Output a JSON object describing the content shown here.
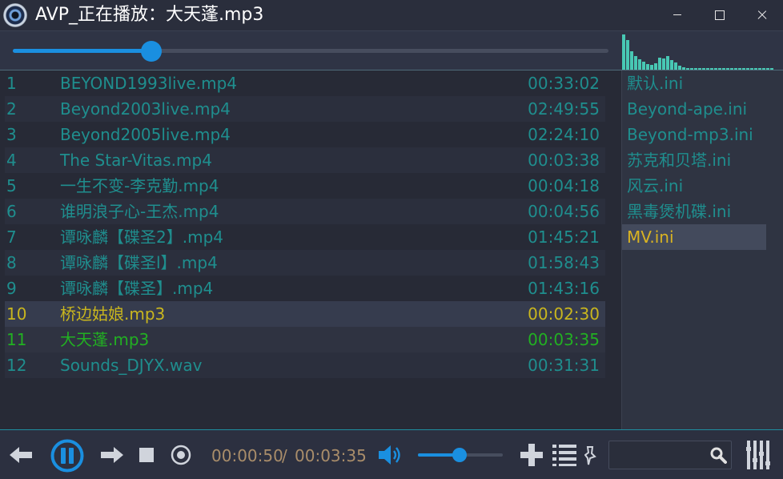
{
  "window": {
    "title": "AVP_正在播放：大天蓬.mp3"
  },
  "seek": {
    "progress": 0.232
  },
  "playlist": {
    "rows": [
      {
        "num": "1",
        "name": "BEYOND1993live.mp4",
        "duration": "00:33:02",
        "state": "normal"
      },
      {
        "num": "2",
        "name": "Beyond2003live.mp4",
        "duration": "02:49:55",
        "state": "normal"
      },
      {
        "num": "3",
        "name": "Beyond2005live.mp4",
        "duration": "02:24:10",
        "state": "normal"
      },
      {
        "num": "4",
        "name": "The Star-Vitas.mp4",
        "duration": "00:03:38",
        "state": "normal"
      },
      {
        "num": "5",
        "name": "一生不变-李克勤.mp4",
        "duration": "00:04:18",
        "state": "normal"
      },
      {
        "num": "6",
        "name": "谁明浪子心-王杰.mp4",
        "duration": "00:04:56",
        "state": "normal"
      },
      {
        "num": "7",
        "name": "谭咏麟【碟圣2】.mp4",
        "duration": "01:45:21",
        "state": "normal"
      },
      {
        "num": "8",
        "name": "谭咏麟【碟圣l】.mp4",
        "duration": "01:58:43",
        "state": "normal"
      },
      {
        "num": "9",
        "name": "谭咏麟【碟圣】.mp4",
        "duration": "01:43:16",
        "state": "normal"
      },
      {
        "num": "10",
        "name": "桥边姑娘.mp3",
        "duration": "00:02:30",
        "state": "selected"
      },
      {
        "num": "11",
        "name": "大天蓬.mp3",
        "duration": "00:03:35",
        "state": "playing"
      },
      {
        "num": "12",
        "name": "Sounds_DJYX.wav",
        "duration": "00:31:31",
        "state": "normal"
      }
    ]
  },
  "presets": {
    "items": [
      {
        "label": "默认.ini",
        "active": false
      },
      {
        "label": "Beyond-ape.ini",
        "active": false
      },
      {
        "label": "Beyond-mp3.ini",
        "active": false
      },
      {
        "label": "苏克和贝塔.ini",
        "active": false
      },
      {
        "label": "风云.ini",
        "active": false
      },
      {
        "label": "黑毒煲机碟.ini",
        "active": false
      },
      {
        "label": "MV.ini",
        "active": true
      }
    ]
  },
  "transport": {
    "time_current": "00:00:50",
    "time_separator": "/",
    "time_total": "00:03:35",
    "volume": 0.49
  },
  "search": {
    "value": "",
    "placeholder": ""
  },
  "spectrum": {
    "levels": [
      0.96,
      0.8,
      0.5,
      0.38,
      0.28,
      0.22,
      0.16,
      0.12,
      0.18,
      0.32,
      0.3,
      0.38,
      0.25,
      0.2,
      0.1,
      0.06,
      0.04,
      0.05,
      0.03,
      0.02,
      0.04,
      0.02,
      0.03,
      0.02,
      0.01,
      0.02,
      0.01,
      0.01,
      0.01,
      0.01,
      0.01,
      0.01,
      0.01,
      0.01,
      0.01,
      0.01,
      0.01,
      0.01
    ]
  },
  "colors": {
    "accent": "#1a8fe0",
    "text_default": "#1f8e8e",
    "text_selected": "#c9b61e",
    "text_playing": "#22b022",
    "spectrum": "#48c8b4",
    "time_text": "#a98d6a"
  }
}
